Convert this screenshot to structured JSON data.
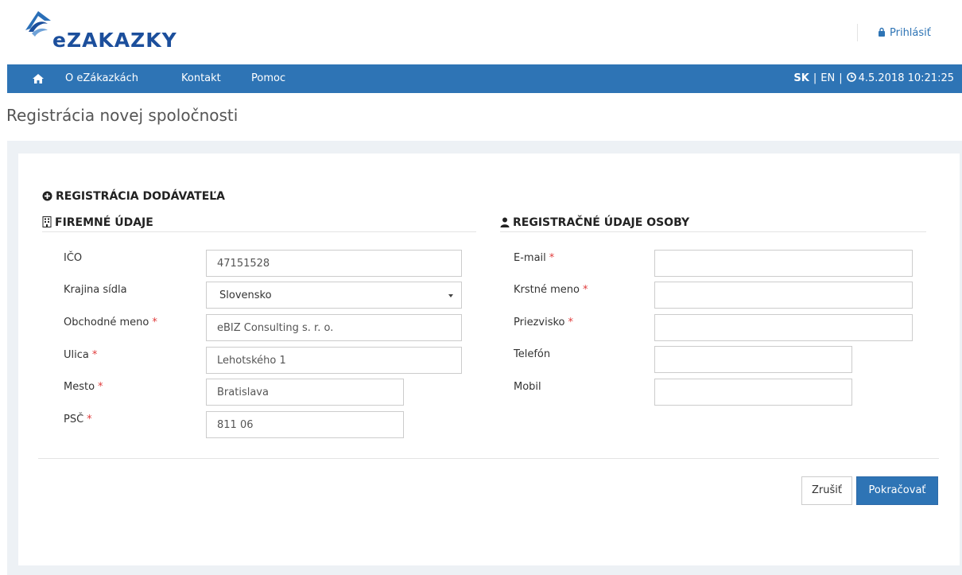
{
  "header": {
    "logo_text": "eZAKAZKY",
    "login_label": "Prihlásiť"
  },
  "nav": {
    "items": [
      "O eZákazkách",
      "Kontakt",
      "Pomoc"
    ],
    "lang_sk": "SK",
    "lang_en": "EN",
    "separator": "|",
    "datetime": "4.5.2018 10:21:25"
  },
  "page": {
    "title": "Registrácia novej spoločnosti"
  },
  "form": {
    "heading": "REGISTRÁCIA DODÁVATEĽA",
    "company": {
      "title": "FIREMNÉ ÚDAJE",
      "fields": [
        {
          "label": "IČO",
          "required": false,
          "value": "47151528"
        },
        {
          "label": "Krajina sídla",
          "required": false,
          "value": "Slovensko"
        },
        {
          "label": "Obchodné meno",
          "required": true,
          "value": "eBIZ Consulting s. r. o."
        },
        {
          "label": "Ulica",
          "required": true,
          "value": "Lehotského 1"
        },
        {
          "label": "Mesto",
          "required": true,
          "value": "Bratislava"
        },
        {
          "label": "PSČ",
          "required": true,
          "value": "811 06"
        }
      ]
    },
    "person": {
      "title": "REGISTRAČNÉ ÚDAJE OSOBY",
      "fields": [
        {
          "label": "E-mail",
          "required": true,
          "value": ""
        },
        {
          "label": "Krstné meno",
          "required": true,
          "value": ""
        },
        {
          "label": "Priezvisko",
          "required": true,
          "value": ""
        },
        {
          "label": "Telefón",
          "required": false,
          "value": ""
        },
        {
          "label": "Mobil",
          "required": false,
          "value": ""
        }
      ]
    },
    "required_mark": "*",
    "cancel_label": "Zrušiť",
    "continue_label": "Pokračovať"
  },
  "icons": {
    "home": "home-icon",
    "lock": "lock-icon",
    "clock": "clock-icon",
    "plus_circle": "plus-circle-icon",
    "building": "building-icon",
    "user": "user-icon"
  },
  "colors": {
    "brand": "#2e74b5",
    "logo": "#1c4f9c",
    "required": "#e03c3c",
    "content_bg": "#edf1f5"
  }
}
